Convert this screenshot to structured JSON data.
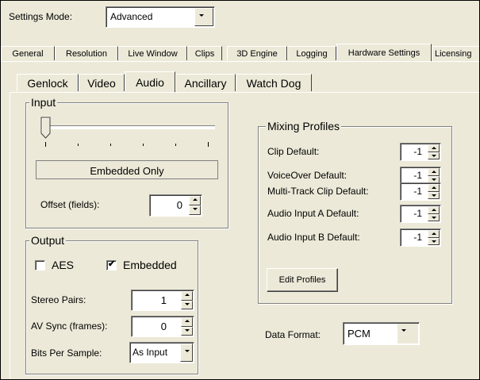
{
  "settings_mode": {
    "label": "Settings Mode:",
    "value": "Advanced"
  },
  "main_tabs": [
    "General",
    "Resolution",
    "Live Window",
    "Clips",
    "3D Engine",
    "Logging",
    "Hardware Settings",
    "Licensing"
  ],
  "main_tab_active": "Hardware Settings",
  "sub_tabs": [
    "Genlock",
    "Video",
    "Audio",
    "Ancillary",
    "Watch Dog"
  ],
  "sub_tab_active": "Audio",
  "input": {
    "title": "Input",
    "source_value": "Embedded Only",
    "offset_label": "Offset (fields):",
    "offset_value": "0"
  },
  "output": {
    "title": "Output",
    "aes_label": "AES",
    "aes_checked": false,
    "embedded_label": "Embedded",
    "embedded_checked": true,
    "check_glyph": "✔",
    "stereo_pairs_label": "Stereo Pairs:",
    "stereo_pairs_value": "1",
    "av_sync_label": "AV Sync (frames):",
    "av_sync_value": "0",
    "bits_label": "Bits Per Sample:",
    "bits_value": "As Input"
  },
  "mixing_profiles": {
    "title": "Mixing Profiles",
    "rows": [
      {
        "label": "Clip Default:",
        "value": "-1"
      },
      {
        "label": "VoiceOver Default:",
        "value": "-1"
      },
      {
        "label": "Multi-Track Clip Default:",
        "value": "-1"
      },
      {
        "label": "Audio Input A Default:",
        "value": "-1"
      },
      {
        "label": "Audio Input B Default:",
        "value": "-1"
      }
    ],
    "edit_button": "Edit Profiles"
  },
  "data_format": {
    "label": "Data Format:",
    "value": "PCM"
  }
}
